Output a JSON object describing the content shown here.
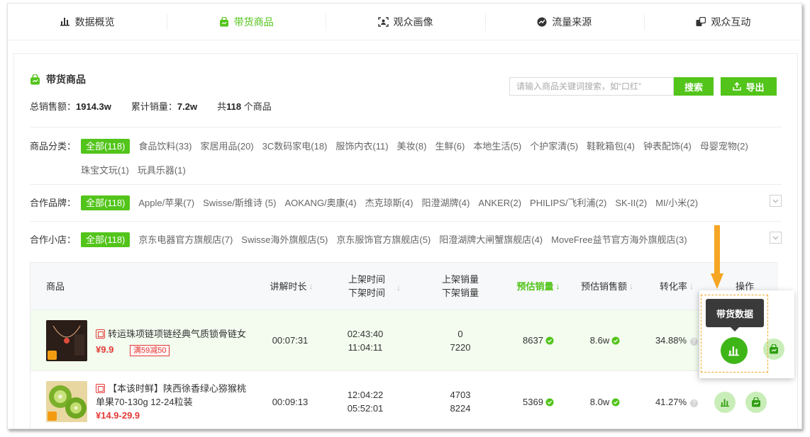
{
  "nav": {
    "tabs": [
      {
        "label": "数据概览",
        "icon": "bar-chart-icon",
        "active": false
      },
      {
        "label": "带货商品",
        "icon": "shopping-bag-icon",
        "active": true
      },
      {
        "label": "观众画像",
        "icon": "portrait-scan-icon",
        "active": false
      },
      {
        "label": "流量来源",
        "icon": "traffic-source-icon",
        "active": false
      },
      {
        "label": "观众互动",
        "icon": "interaction-icon",
        "active": false
      }
    ]
  },
  "header": {
    "title": "带货商品",
    "stats": {
      "sales_label": "总销售额：",
      "sales_value": "1914.3w",
      "volume_label": "累计销量：",
      "volume_value": "7.2w",
      "count_prefix": "共",
      "count_value": "118",
      "count_suffix": " 个商品"
    },
    "search_placeholder": "请输入商品关键词搜索，如“口红”",
    "search_button": "搜索",
    "export_button": "导出"
  },
  "filters": [
    {
      "label": "商品分类：",
      "options": [
        "全部(118)",
        "食品饮料(33)",
        "家居用品(20)",
        "3C数码家电(18)",
        "服饰内衣(11)",
        "美妆(8)",
        "生鲜(6)",
        "本地生活(5)",
        "个护家清(5)",
        "鞋靴箱包(4)",
        "钟表配饰(4)",
        "母婴宠物(2)",
        "珠宝文玩(1)",
        "玩具乐器(1)"
      ],
      "selected": 0,
      "expandable": false
    },
    {
      "label": "合作品牌：",
      "options": [
        "全部(118)",
        "Apple/苹果(7)",
        "Swisse/斯维诗 (5)",
        "AOKANG/奥康(4)",
        "杰克琼斯(4)",
        "阳澄湖牌(4)",
        "ANKER(2)",
        "PHILIPS/飞利浦(2)",
        "SK-II(2)",
        "MI/小米(2)"
      ],
      "selected": 0,
      "expandable": true
    },
    {
      "label": "合作小店：",
      "options": [
        "全部(118)",
        "京东电器官方旗舰店(7)",
        "Swisse海外旗舰店(5)",
        "京东服饰官方旗舰店(5)",
        "阳澄湖牌大闸蟹旗舰店(4)",
        "MoveFree益节官方海外旗舰店(3)"
      ],
      "selected": 0,
      "expandable": true
    }
  ],
  "table": {
    "columns": {
      "product": "商品",
      "duration": "讲解时长",
      "time_on": "上架时间",
      "time_off": "下架时间",
      "sales_on": "上架销量",
      "sales_off": "下架销量",
      "est_sales": "预估销量",
      "est_amount": "预估销售额",
      "conversion": "转化率",
      "ops": "操作"
    },
    "rows": [
      {
        "name": "转运珠项链项链经典气质锁骨链女",
        "price": "¥9.9",
        "coupon": "满59减50",
        "duration": "00:07:31",
        "time_on": "02:43:40",
        "time_off": "11:04:11",
        "sales_on": "0",
        "sales_off": "7220",
        "est_sales": "8637",
        "est_amount": "8.6w",
        "conversion": "34.88%"
      },
      {
        "name": "【本该时鲜】陕西徐香绿心猕猴桃单果70-130g 12-24粒装",
        "price": "¥14.9-29.9",
        "coupon": "",
        "duration": "00:09:13",
        "time_on": "12:04:22",
        "time_off": "05:52:01",
        "sales_on": "4703",
        "sales_off": "8224",
        "est_sales": "5369",
        "est_amount": "8.0w",
        "conversion": "41.27%"
      }
    ]
  },
  "tooltip": "带货数据",
  "colors": {
    "accent": "#52c41a",
    "price": "#e53935",
    "highlight": "#f5a623"
  }
}
